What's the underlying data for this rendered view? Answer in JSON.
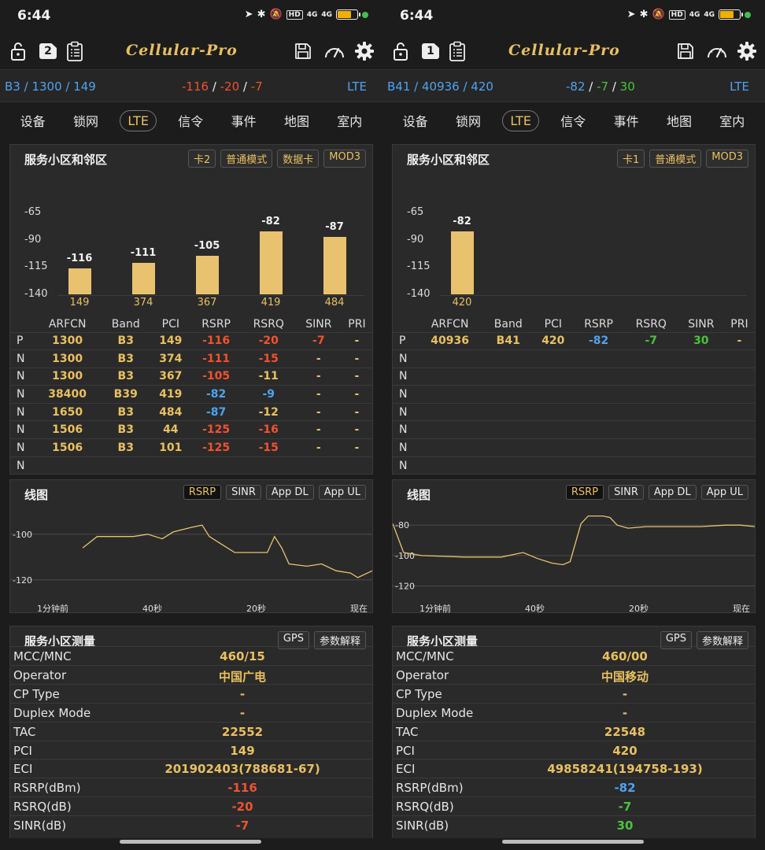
{
  "panels": [
    {
      "status": {
        "time": "6:44",
        "network": "4G",
        "hd": "HD",
        "sim2": "4G"
      },
      "toolbar": {
        "sim_number": "2",
        "logo": "Cellular-Pro"
      },
      "cellbar": {
        "band": "B3",
        "arfcn": "1300",
        "pci": "149",
        "rsrp": "-116",
        "rsrq": "-20",
        "sinr": "-7",
        "tech": "LTE",
        "rsrp_color": "#f0532d",
        "rsrq_color": "#f0532d",
        "sinr_color": "#f0532d"
      },
      "tabs": [
        "设备",
        "锁网",
        "LTE",
        "信令",
        "事件",
        "地图",
        "室内"
      ],
      "active_tab": 2,
      "cells_card": {
        "title": "服务小区和邻区",
        "chips": [
          "卡2",
          "普通模式",
          "数据卡",
          "MOD3"
        ]
      },
      "chart_data": {
        "type": "bar",
        "categories": [
          "149",
          "374",
          "367",
          "419",
          "484"
        ],
        "values": [
          -116,
          -111,
          -105,
          -82,
          -87
        ],
        "yticks": [
          "-65",
          "-90",
          "-115",
          "-140"
        ],
        "ylim": [
          -140,
          -55
        ]
      },
      "table": {
        "headers": [
          "",
          "ARFCN",
          "Band",
          "PCI",
          "RSRP",
          "RSRQ",
          "SINR",
          "PRI"
        ],
        "rows": [
          {
            "type": "P",
            "arfcn": "1300",
            "band": "B3",
            "pci": "149",
            "rsrp": "-116",
            "rsrq": "-20",
            "sinr": "-7",
            "pri": "-",
            "rsrp_c": "#f0532d",
            "rsrq_c": "#f0532d",
            "sinr_c": "#f0532d"
          },
          {
            "type": "N",
            "arfcn": "1300",
            "band": "B3",
            "pci": "374",
            "rsrp": "-111",
            "rsrq": "-15",
            "sinr": "-",
            "pri": "-",
            "rsrp_c": "#f0532d",
            "rsrq_c": "#f0532d",
            "sinr_c": "#e9c060"
          },
          {
            "type": "N",
            "arfcn": "1300",
            "band": "B3",
            "pci": "367",
            "rsrp": "-105",
            "rsrq": "-11",
            "sinr": "-",
            "pri": "-",
            "rsrp_c": "#f0532d",
            "rsrq_c": "#e9c060",
            "sinr_c": "#e9c060"
          },
          {
            "type": "N",
            "arfcn": "38400",
            "band": "B39",
            "pci": "419",
            "rsrp": "-82",
            "rsrq": "-9",
            "sinr": "-",
            "pri": "-",
            "rsrp_c": "#4ea3f0",
            "rsrq_c": "#4ea3f0",
            "sinr_c": "#e9c060"
          },
          {
            "type": "N",
            "arfcn": "1650",
            "band": "B3",
            "pci": "484",
            "rsrp": "-87",
            "rsrq": "-12",
            "sinr": "-",
            "pri": "-",
            "rsrp_c": "#4ea3f0",
            "rsrq_c": "#e9c060",
            "sinr_c": "#e9c060"
          },
          {
            "type": "N",
            "arfcn": "1506",
            "band": "B3",
            "pci": "44",
            "rsrp": "-125",
            "rsrq": "-16",
            "sinr": "-",
            "pri": "-",
            "rsrp_c": "#f0532d",
            "rsrq_c": "#f0532d",
            "sinr_c": "#e9c060"
          },
          {
            "type": "N",
            "arfcn": "1506",
            "band": "B3",
            "pci": "101",
            "rsrp": "-125",
            "rsrq": "-15",
            "sinr": "-",
            "pri": "-",
            "rsrp_c": "#f0532d",
            "rsrq_c": "#f0532d",
            "sinr_c": "#e9c060"
          },
          {
            "type": "N",
            "arfcn": "",
            "band": "",
            "pci": "",
            "rsrp": "",
            "rsrq": "",
            "sinr": "",
            "pri": "",
            "rsrp_c": "#e9c060",
            "rsrq_c": "#e9c060",
            "sinr_c": "#e9c060"
          }
        ]
      },
      "line_card": {
        "title": "线图",
        "chips": [
          "RSRP",
          "SINR",
          "App DL",
          "App UL"
        ],
        "yticks": [
          "-100",
          "-120"
        ],
        "ylim": [
          -128,
          -88
        ],
        "xlabels": [
          "1分钟前",
          "40秒",
          "20秒",
          "现在"
        ],
        "series": [
          [
            0.2,
            -106
          ],
          [
            0.24,
            -101
          ],
          [
            0.28,
            -101
          ],
          [
            0.34,
            -101
          ],
          [
            0.38,
            -100
          ],
          [
            0.42,
            -102
          ],
          [
            0.45,
            -99
          ],
          [
            0.5,
            -97
          ],
          [
            0.53,
            -96
          ],
          [
            0.55,
            -101
          ],
          [
            0.58,
            -104
          ],
          [
            0.62,
            -108
          ],
          [
            0.68,
            -108
          ],
          [
            0.71,
            -108
          ],
          [
            0.73,
            -101
          ],
          [
            0.75,
            -106
          ],
          [
            0.77,
            -113
          ],
          [
            0.82,
            -114
          ],
          [
            0.86,
            -113
          ],
          [
            0.9,
            -116
          ],
          [
            0.94,
            -117
          ],
          [
            0.96,
            -119
          ],
          [
            1.0,
            -116
          ]
        ]
      },
      "meas_card": {
        "title": "服务小区测量",
        "chips": [
          "GPS",
          "参数解释"
        ],
        "rows": [
          {
            "k": "MCC/MNC",
            "v": "460/15",
            "c": "#e9c060"
          },
          {
            "k": "Operator",
            "v": "中国广电",
            "c": "#e9c060"
          },
          {
            "k": "CP Type",
            "v": "-",
            "c": "#e9c060"
          },
          {
            "k": "Duplex Mode",
            "v": "-",
            "c": "#e9c060"
          },
          {
            "k": "TAC",
            "v": "22552",
            "c": "#e9c060"
          },
          {
            "k": "PCI",
            "v": "149",
            "c": "#e9c060"
          },
          {
            "k": "ECI",
            "v": "201902403(788681-67)",
            "c": "#e9c060"
          },
          {
            "k": "RSRP(dBm)",
            "v": "-116",
            "c": "#f0532d"
          },
          {
            "k": "RSRQ(dB)",
            "v": "-20",
            "c": "#f0532d"
          },
          {
            "k": "SINR(dB)",
            "v": "-7",
            "c": "#f0532d"
          }
        ]
      }
    },
    {
      "status": {
        "time": "6:44",
        "network": "4G",
        "hd": "HD",
        "sim2": "4G"
      },
      "toolbar": {
        "sim_number": "1",
        "logo": "Cellular-Pro"
      },
      "cellbar": {
        "band": "B41",
        "arfcn": "40936",
        "pci": "420",
        "rsrp": "-82",
        "rsrq": "-7",
        "sinr": "30",
        "tech": "LTE",
        "rsrp_color": "#4ea3f0",
        "rsrq_color": "#4cc23c",
        "sinr_color": "#4cc23c"
      },
      "tabs": [
        "设备",
        "锁网",
        "LTE",
        "信令",
        "事件",
        "地图",
        "室内"
      ],
      "active_tab": 2,
      "cells_card": {
        "title": "服务小区和邻区",
        "chips": [
          "卡1",
          "普通模式",
          "MOD3"
        ]
      },
      "chart_data": {
        "type": "bar",
        "categories": [
          "420"
        ],
        "values": [
          -82
        ],
        "yticks": [
          "-65",
          "-90",
          "-115",
          "-140"
        ],
        "ylim": [
          -140,
          -55
        ]
      },
      "table": {
        "headers": [
          "",
          "ARFCN",
          "Band",
          "PCI",
          "RSRP",
          "RSRQ",
          "SINR",
          "PRI"
        ],
        "rows": [
          {
            "type": "P",
            "arfcn": "40936",
            "band": "B41",
            "pci": "420",
            "rsrp": "-82",
            "rsrq": "-7",
            "sinr": "30",
            "pri": "-",
            "rsrp_c": "#4ea3f0",
            "rsrq_c": "#4cc23c",
            "sinr_c": "#4cc23c"
          },
          {
            "type": "N",
            "arfcn": "",
            "band": "",
            "pci": "",
            "rsrp": "",
            "rsrq": "",
            "sinr": "",
            "pri": "",
            "rsrp_c": "#e9c060",
            "rsrq_c": "#e9c060",
            "sinr_c": "#e9c060"
          },
          {
            "type": "N",
            "arfcn": "",
            "band": "",
            "pci": "",
            "rsrp": "",
            "rsrq": "",
            "sinr": "",
            "pri": "",
            "rsrp_c": "#e9c060",
            "rsrq_c": "#e9c060",
            "sinr_c": "#e9c060"
          },
          {
            "type": "N",
            "arfcn": "",
            "band": "",
            "pci": "",
            "rsrp": "",
            "rsrq": "",
            "sinr": "",
            "pri": "",
            "rsrp_c": "#e9c060",
            "rsrq_c": "#e9c060",
            "sinr_c": "#e9c060"
          },
          {
            "type": "N",
            "arfcn": "",
            "band": "",
            "pci": "",
            "rsrp": "",
            "rsrq": "",
            "sinr": "",
            "pri": "",
            "rsrp_c": "#e9c060",
            "rsrq_c": "#e9c060",
            "sinr_c": "#e9c060"
          },
          {
            "type": "N",
            "arfcn": "",
            "band": "",
            "pci": "",
            "rsrp": "",
            "rsrq": "",
            "sinr": "",
            "pri": "",
            "rsrp_c": "#e9c060",
            "rsrq_c": "#e9c060",
            "sinr_c": "#e9c060"
          },
          {
            "type": "N",
            "arfcn": "",
            "band": "",
            "pci": "",
            "rsrp": "",
            "rsrq": "",
            "sinr": "",
            "pri": "",
            "rsrp_c": "#e9c060",
            "rsrq_c": "#e9c060",
            "sinr_c": "#e9c060"
          },
          {
            "type": "N",
            "arfcn": "",
            "band": "",
            "pci": "",
            "rsrp": "",
            "rsrq": "",
            "sinr": "",
            "pri": "",
            "rsrp_c": "#e9c060",
            "rsrq_c": "#e9c060",
            "sinr_c": "#e9c060"
          }
        ]
      },
      "line_card": {
        "title": "线图",
        "chips": [
          "RSRP",
          "SINR",
          "App DL",
          "App UL"
        ],
        "yticks": [
          "-80",
          "-100",
          "-120"
        ],
        "ylim": [
          -128,
          -68
        ],
        "xlabels": [
          "1分钟前",
          "40秒",
          "20秒",
          "现在"
        ],
        "series": [
          [
            0.0,
            -79
          ],
          [
            0.03,
            -98
          ],
          [
            0.08,
            -100
          ],
          [
            0.2,
            -101
          ],
          [
            0.3,
            -101
          ],
          [
            0.36,
            -98
          ],
          [
            0.4,
            -102
          ],
          [
            0.44,
            -105
          ],
          [
            0.47,
            -106
          ],
          [
            0.49,
            -104
          ],
          [
            0.52,
            -79
          ],
          [
            0.54,
            -74
          ],
          [
            0.58,
            -74
          ],
          [
            0.6,
            -75
          ],
          [
            0.62,
            -80
          ],
          [
            0.65,
            -82
          ],
          [
            0.7,
            -81
          ],
          [
            0.78,
            -81
          ],
          [
            0.85,
            -81
          ],
          [
            0.92,
            -80
          ],
          [
            0.96,
            -80
          ],
          [
            1.0,
            -81
          ]
        ]
      },
      "meas_card": {
        "title": "服务小区测量",
        "chips": [
          "GPS",
          "参数解释"
        ],
        "rows": [
          {
            "k": "MCC/MNC",
            "v": "460/00",
            "c": "#e9c060"
          },
          {
            "k": "Operator",
            "v": "中国移动",
            "c": "#e9c060"
          },
          {
            "k": "CP Type",
            "v": "-",
            "c": "#e9c060"
          },
          {
            "k": "Duplex Mode",
            "v": "-",
            "c": "#e9c060"
          },
          {
            "k": "TAC",
            "v": "22548",
            "c": "#e9c060"
          },
          {
            "k": "PCI",
            "v": "420",
            "c": "#e9c060"
          },
          {
            "k": "ECI",
            "v": "49858241(194758-193)",
            "c": "#e9c060"
          },
          {
            "k": "RSRP(dBm)",
            "v": "-82",
            "c": "#4ea3f0"
          },
          {
            "k": "RSRQ(dB)",
            "v": "-7",
            "c": "#4cc23c"
          },
          {
            "k": "SINR(dB)",
            "v": "30",
            "c": "#4cc23c"
          }
        ]
      }
    }
  ]
}
